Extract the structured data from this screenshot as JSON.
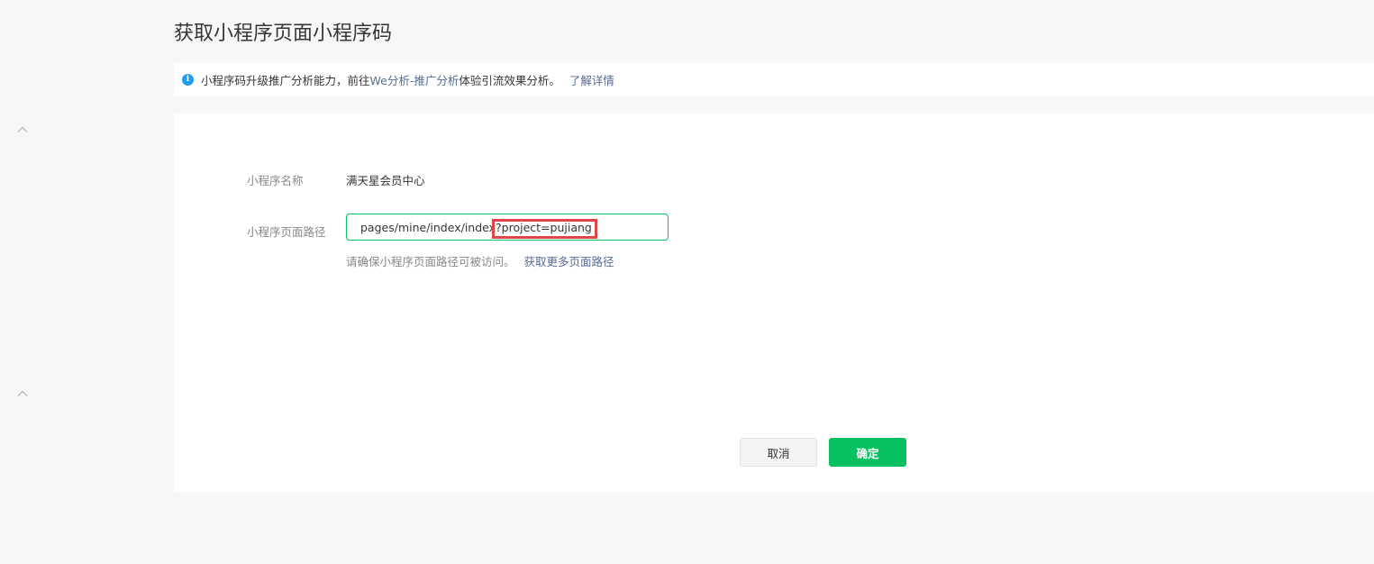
{
  "page": {
    "title": "获取小程序页面小程序码"
  },
  "notice": {
    "text_before": "小程序码升级推广分析能力，前往",
    "link_analytics": "We分析-推广分析",
    "text_after": "体验引流效果分析。",
    "link_details": "了解详情",
    "icon": "info-icon",
    "icon_glyph": "i",
    "icon_color": "#1e9cf0"
  },
  "form": {
    "name_label": "小程序名称",
    "name_value": "满天星会员中心",
    "path_label": "小程序页面路径",
    "path_value": "pages/mine/index/index?project=pujiang",
    "path_hint": "请确保小程序页面路径可被访问。",
    "path_hint_link": "获取更多页面路径"
  },
  "actions": {
    "cancel_label": "取消",
    "confirm_label": "确定"
  },
  "colors": {
    "brand_green": "#07c160",
    "link_blue": "#576b95",
    "annotation_red": "#e0454a"
  }
}
